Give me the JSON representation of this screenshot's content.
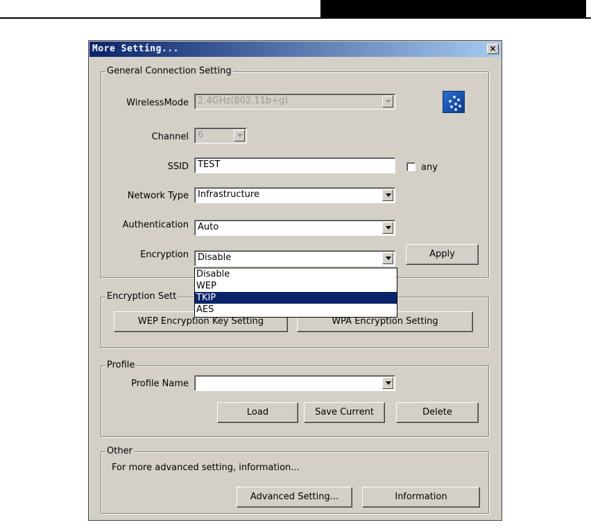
{
  "dialog": {
    "title": "More Setting...",
    "close_glyph": "×"
  },
  "general": {
    "legend": "General Connection Setting",
    "wireless_mode_label": "WirelessMode",
    "wireless_mode_value": "2.4GHz(802.11b+g)",
    "channel_label": "Channel",
    "channel_value": "6",
    "ssid_label": "SSID",
    "ssid_value": "TEST",
    "any_label": "any",
    "network_type_label": "Network Type",
    "network_type_value": "Infrastructure",
    "authentication_label": "Authentication",
    "authentication_value": "Auto",
    "encryption_label": "Encryption",
    "encryption_value": "Disable",
    "apply_label": "Apply",
    "icon": "wireless-network-icon"
  },
  "encryption_dropdown": {
    "options": [
      "Disable",
      "WEP",
      "TKIP",
      "AES"
    ],
    "highlighted": "TKIP"
  },
  "encryption_setting": {
    "legend": "Encryption Setting",
    "legend_visible": "Encryption Sett",
    "wep_button": "WEP Encryption Key Setting",
    "wpa_button": "WPA Encryption Setting"
  },
  "profile": {
    "legend": "Profile",
    "name_label": "Profile Name",
    "name_value": "",
    "load_label": "Load",
    "save_label": "Save Current",
    "delete_label": "Delete"
  },
  "other": {
    "legend": "Other",
    "description": "For more advanced setting, information...",
    "advanced_label": "Advanced Setting...",
    "information_label": "Information"
  },
  "colors": {
    "titlebar_start": "#0a246a",
    "titlebar_end": "#a6caf0",
    "dialog_bg": "#d4d0c8",
    "selection": "#0a246a"
  }
}
